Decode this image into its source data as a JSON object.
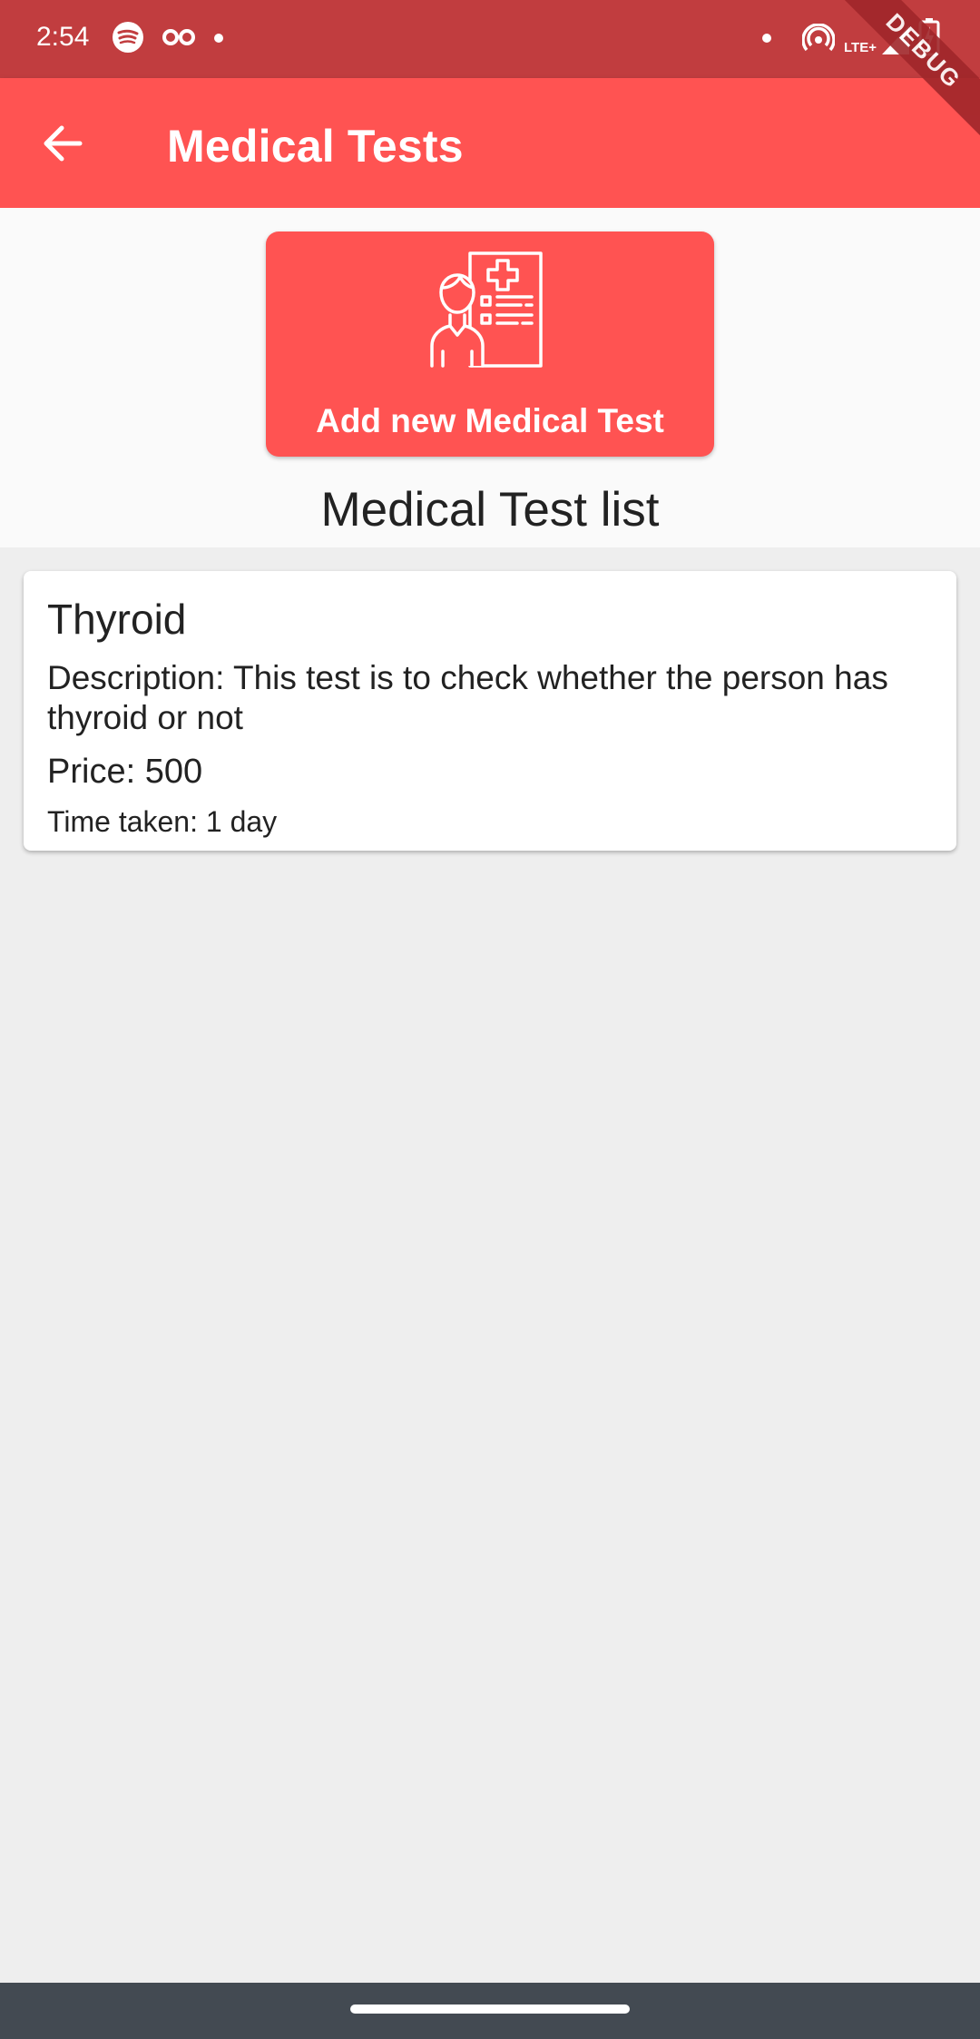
{
  "status_bar": {
    "time": "2:54",
    "icons": [
      "spotify-icon",
      "glasses-icon",
      "dot-icon",
      "hotspot-icon",
      "lte-signal-icon",
      "battery-icon"
    ],
    "network_label": "LTE+"
  },
  "app_bar": {
    "title": "Medical Tests",
    "back_icon": "arrow-back-icon",
    "background": "#ff5352"
  },
  "debug_banner": "DEBUG",
  "add_button": {
    "label": "Add new Medical Test",
    "icon": "medical-report-icon"
  },
  "list_heading": "Medical Test list",
  "tests": [
    {
      "name": "Thyroid",
      "description": "Description: This test is to check whether the person has thyroid or not",
      "price": "Price: 500",
      "time_taken": "Time taken: 1 day"
    }
  ],
  "colors": {
    "accent": "#ff5352",
    "status_bar": "#c13d3f",
    "background": "#eeeeee"
  }
}
